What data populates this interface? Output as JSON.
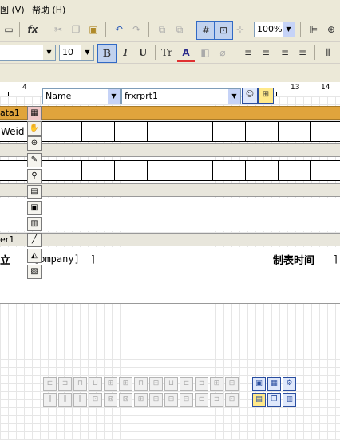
{
  "menu": [
    "图 (V)",
    "帮助 (H)"
  ],
  "toolbar1": {
    "zoom": "100%",
    "buttons": [
      "open",
      "fx",
      "cut",
      "copy",
      "paste",
      "undo",
      "redo",
      "group",
      "ungroup",
      "grid",
      "fit-grid",
      "align-grid"
    ]
  },
  "toolbar2": {
    "font_size": "10",
    "bold": "B",
    "italic": "I",
    "underline": "U",
    "highlight": "Tr",
    "font_color": "A"
  },
  "object_bar": {
    "name_value": "Name",
    "object_value": "frxrprt1"
  },
  "ruler": {
    "numbers": [
      "4",
      "13",
      "14"
    ]
  },
  "bands": {
    "masterdata": {
      "label": "ata1",
      "color": "#e0a43c"
    },
    "data_row_text": "Weid",
    "footer": {
      "label": "er1"
    },
    "footer_left": "立",
    "footer_field": "[ompany]",
    "footer_right": "制表时间"
  }
}
